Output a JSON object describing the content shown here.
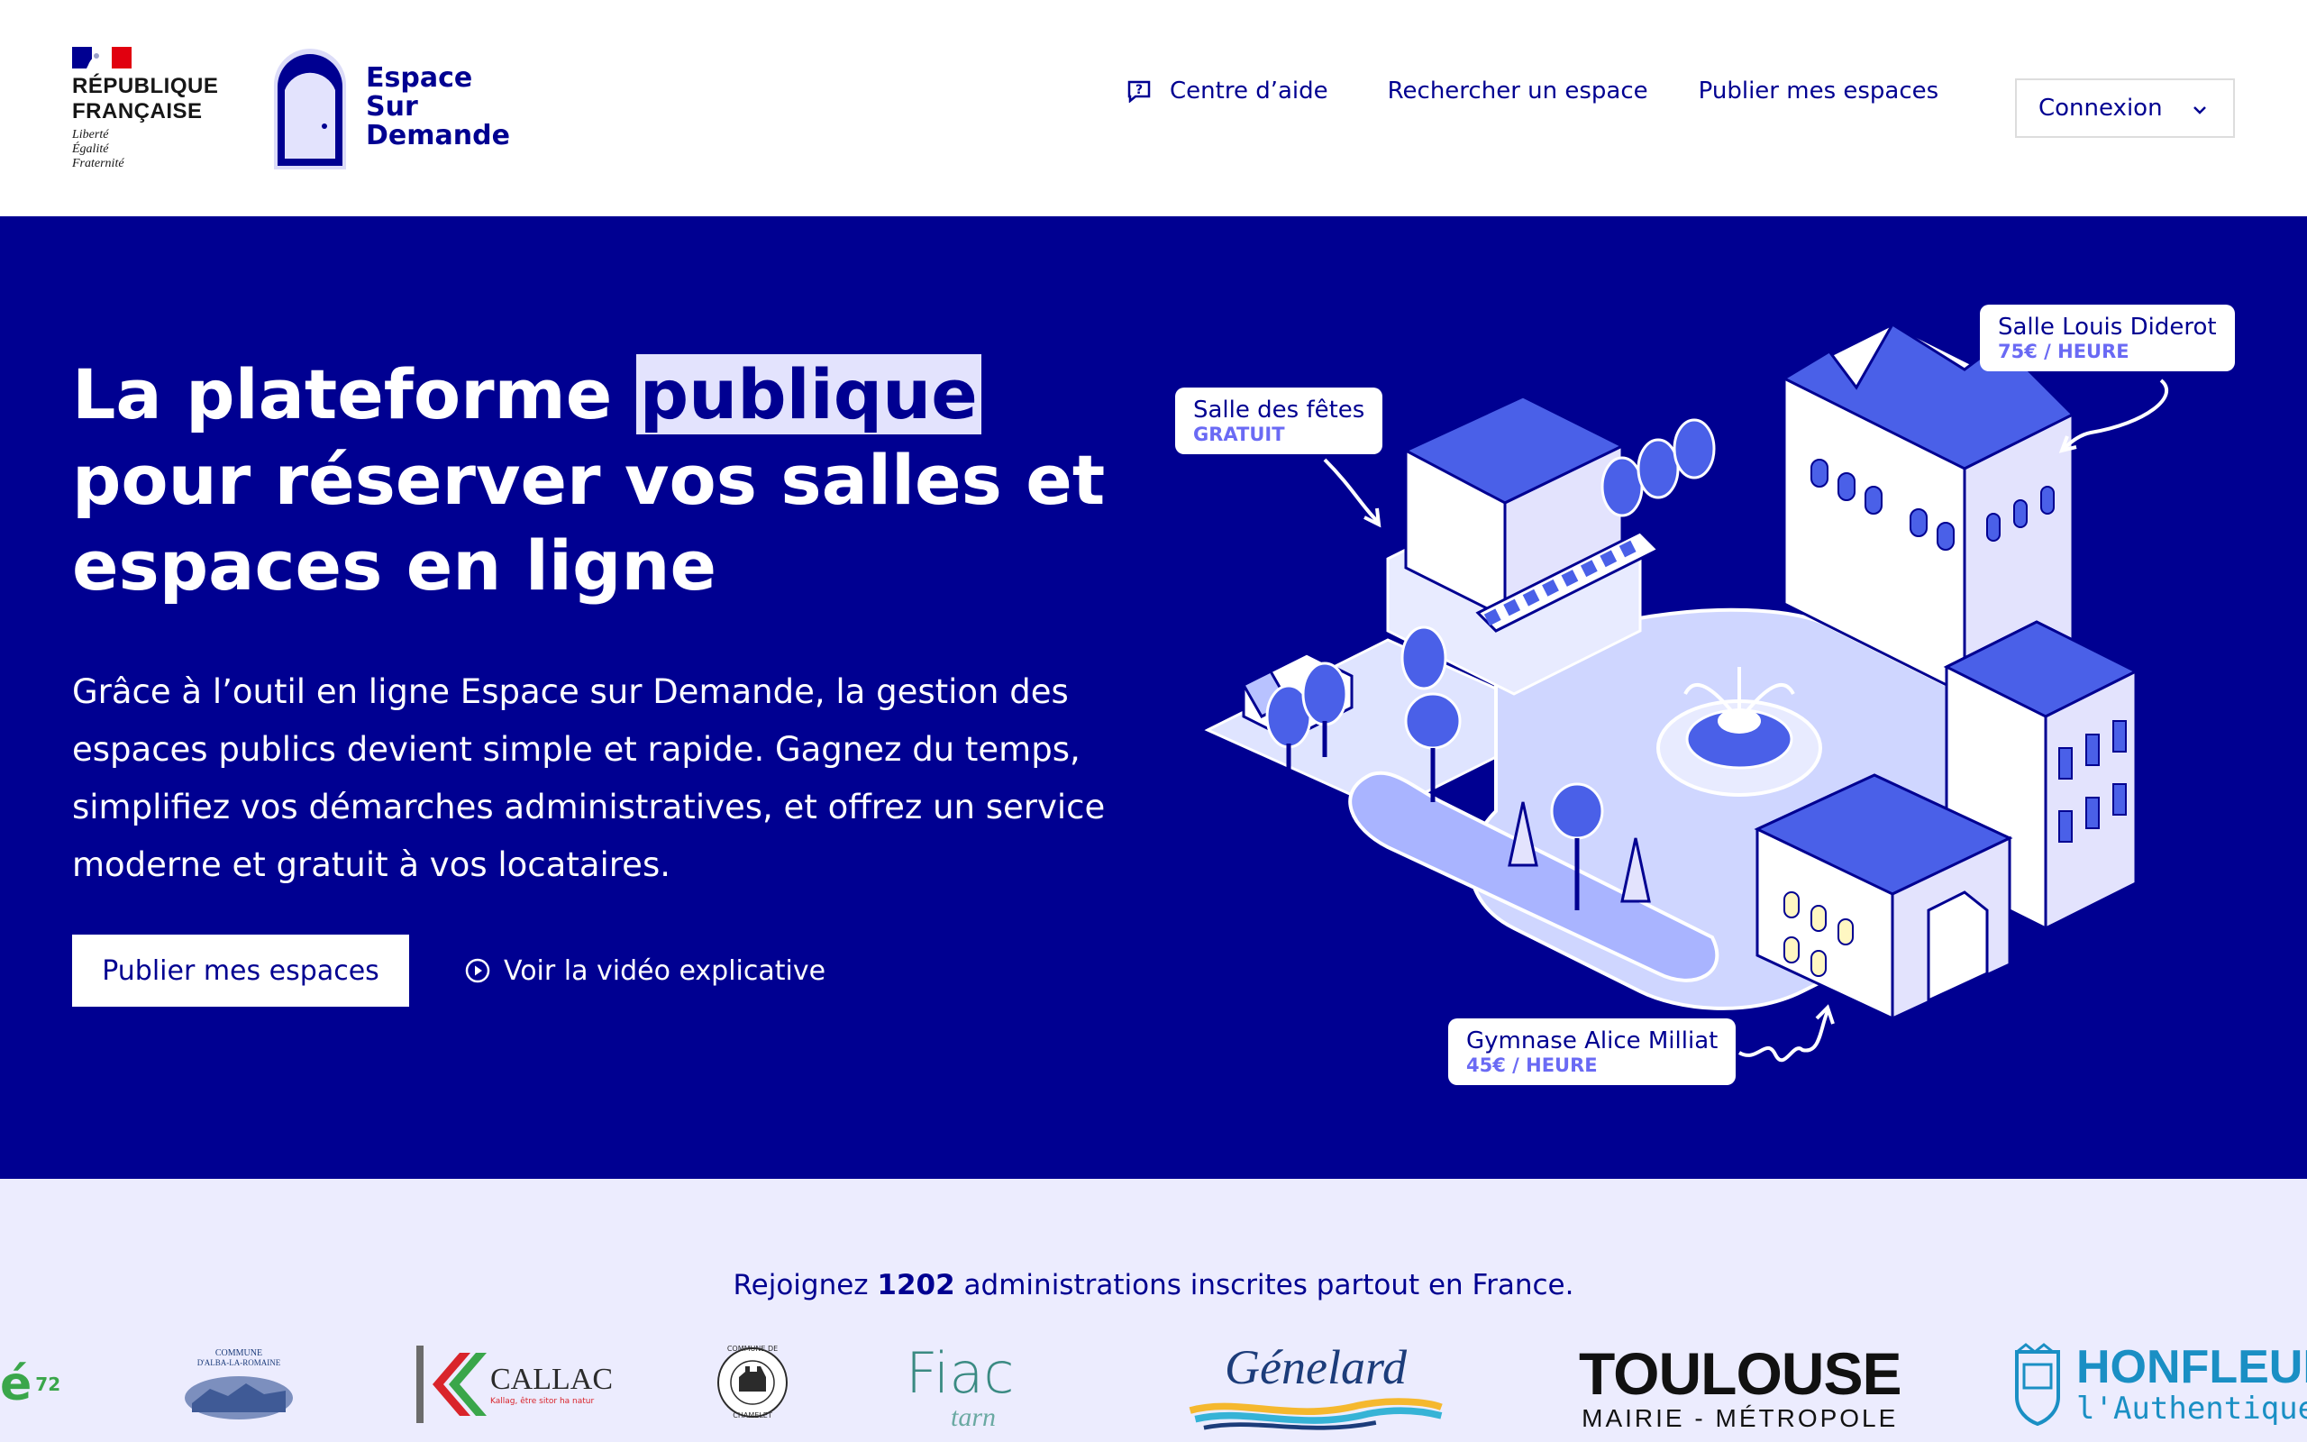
{
  "header": {
    "gov_line1": "RÉPUBLIQUE",
    "gov_line2": "FRANÇAISE",
    "motto1": "Liberté",
    "motto2": "Égalité",
    "motto3": "Fraternité",
    "brand_line1": "Espace",
    "brand_line2": "Sur",
    "brand_line3": "Demande",
    "nav": {
      "help": "Centre d’aide",
      "search": "Rechercher un espace",
      "publish": "Publier mes espaces"
    },
    "login_label": "Connexion"
  },
  "hero": {
    "title_before": "La plateforme ",
    "title_highlight": "publique",
    "title_after": " pour réserver vos salles et espaces en ligne",
    "lead": "Grâce à l’outil en ligne Espace sur Demande, la gestion des espaces publics devient simple et rapide. Gagnez du temps, simplifiez vos démarches administratives, et offrez un service moderne et gratuit à vos locataires.",
    "cta_primary": "Publier mes espaces",
    "cta_video": "Voir la vidéo explicative",
    "tags": [
      {
        "name": "Salle des fêtes",
        "price": "GRATUIT"
      },
      {
        "name": "Salle Louis Diderot",
        "price": "75€ / HEURE"
      },
      {
        "name": "Gymnase Alice Milliat",
        "price": "45€ / HEURE"
      }
    ]
  },
  "partners": {
    "join_before": "Rejoignez ",
    "join_count": "1202",
    "join_after": " administrations inscrites partout en France.",
    "logos": {
      "partial_left": "é",
      "partial_left_sup": "72",
      "alba_arc": "COMMUNE",
      "alba_name": "D'ALBA-LA-ROMAINE",
      "callac": "CALLAC",
      "callac_tagline": "Kallag, être sitor ha natur",
      "chamelet_top": "COMMUNE DE",
      "chamelet_bottom": "CHAMELET",
      "fiac": "Fiac",
      "fiac_sub": "tarn",
      "genelard": "Génelard",
      "toulouse": "TOULOUSE",
      "toulouse_sub": "MAIRIE - MÉTROPOLE",
      "honfleur": "HONFLEUR",
      "honfleur_sub": "l'Authentique"
    }
  },
  "colors": {
    "primary": "#000091",
    "highlight": "#e3e3fd",
    "accent": "#6a6af4",
    "partners_bg": "#ececfe"
  }
}
